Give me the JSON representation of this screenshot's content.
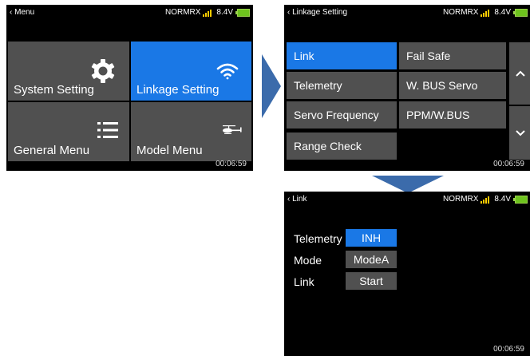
{
  "colors": {
    "accent": "#1a78e6",
    "tile": "#505050",
    "screen": "#000000",
    "arrow": "#3b6bab",
    "signal": "#ffcc00",
    "battery": "#6ec31e"
  },
  "status": {
    "mode": "NORMRX",
    "voltage": "8.4V",
    "time": "00:06:59"
  },
  "screen_menu": {
    "back_label": "Menu",
    "tiles": [
      {
        "label": "System Setting",
        "icon": "gear-icon",
        "active": false
      },
      {
        "label": "Linkage Setting",
        "icon": "wifi-icon",
        "active": true
      },
      {
        "label": "General Menu",
        "icon": "list-icon",
        "active": false
      },
      {
        "label": "Model Menu",
        "icon": "helicopter-icon",
        "active": false
      }
    ]
  },
  "screen_linkage": {
    "back_label": "Linkage Setting",
    "left_items": [
      "Link",
      "Telemetry",
      "Servo Frequency",
      "Range Check"
    ],
    "right_items": [
      "Fail Safe",
      "W. BUS Servo",
      "PPM/W.BUS"
    ],
    "up_icon": "chevron-up-icon",
    "down_icon": "chevron-down-icon"
  },
  "screen_link": {
    "back_label": "Link",
    "rows": [
      {
        "label": "Telemetry",
        "value": "INH"
      },
      {
        "label": "Mode",
        "value": "ModeA"
      },
      {
        "label": "Link",
        "value": "Start"
      }
    ]
  }
}
